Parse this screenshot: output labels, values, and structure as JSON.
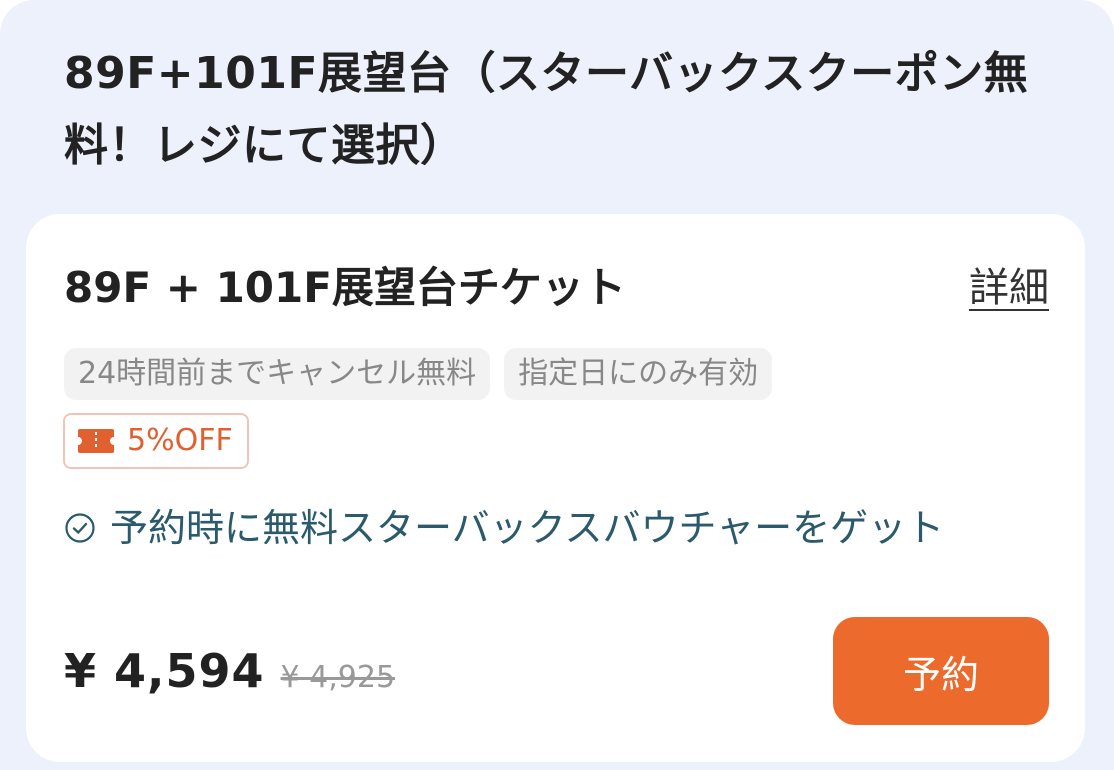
{
  "package": {
    "title": "89F+101F展望台（スターバックスクーポン無料！レジにて選択）"
  },
  "ticket": {
    "name": "89F + 101F展望台チケット",
    "details_label": "詳細",
    "tags": [
      "24時間前までキャンセル無料",
      "指定日にのみ有効"
    ],
    "coupon": {
      "icon": "ticket-icon",
      "label": "5%OFF"
    },
    "perk": {
      "icon": "check-circle-icon",
      "text": "予約時に無料スターバックスバウチャーをゲット"
    },
    "price": "¥ 4,594",
    "original_price": "¥ 4,925",
    "book_label": "予約"
  },
  "colors": {
    "panel_bg": "#ecf1fb",
    "accent": "#ec6a2c",
    "coupon_text": "#e0612f",
    "perk_text": "#2a5a6b"
  }
}
